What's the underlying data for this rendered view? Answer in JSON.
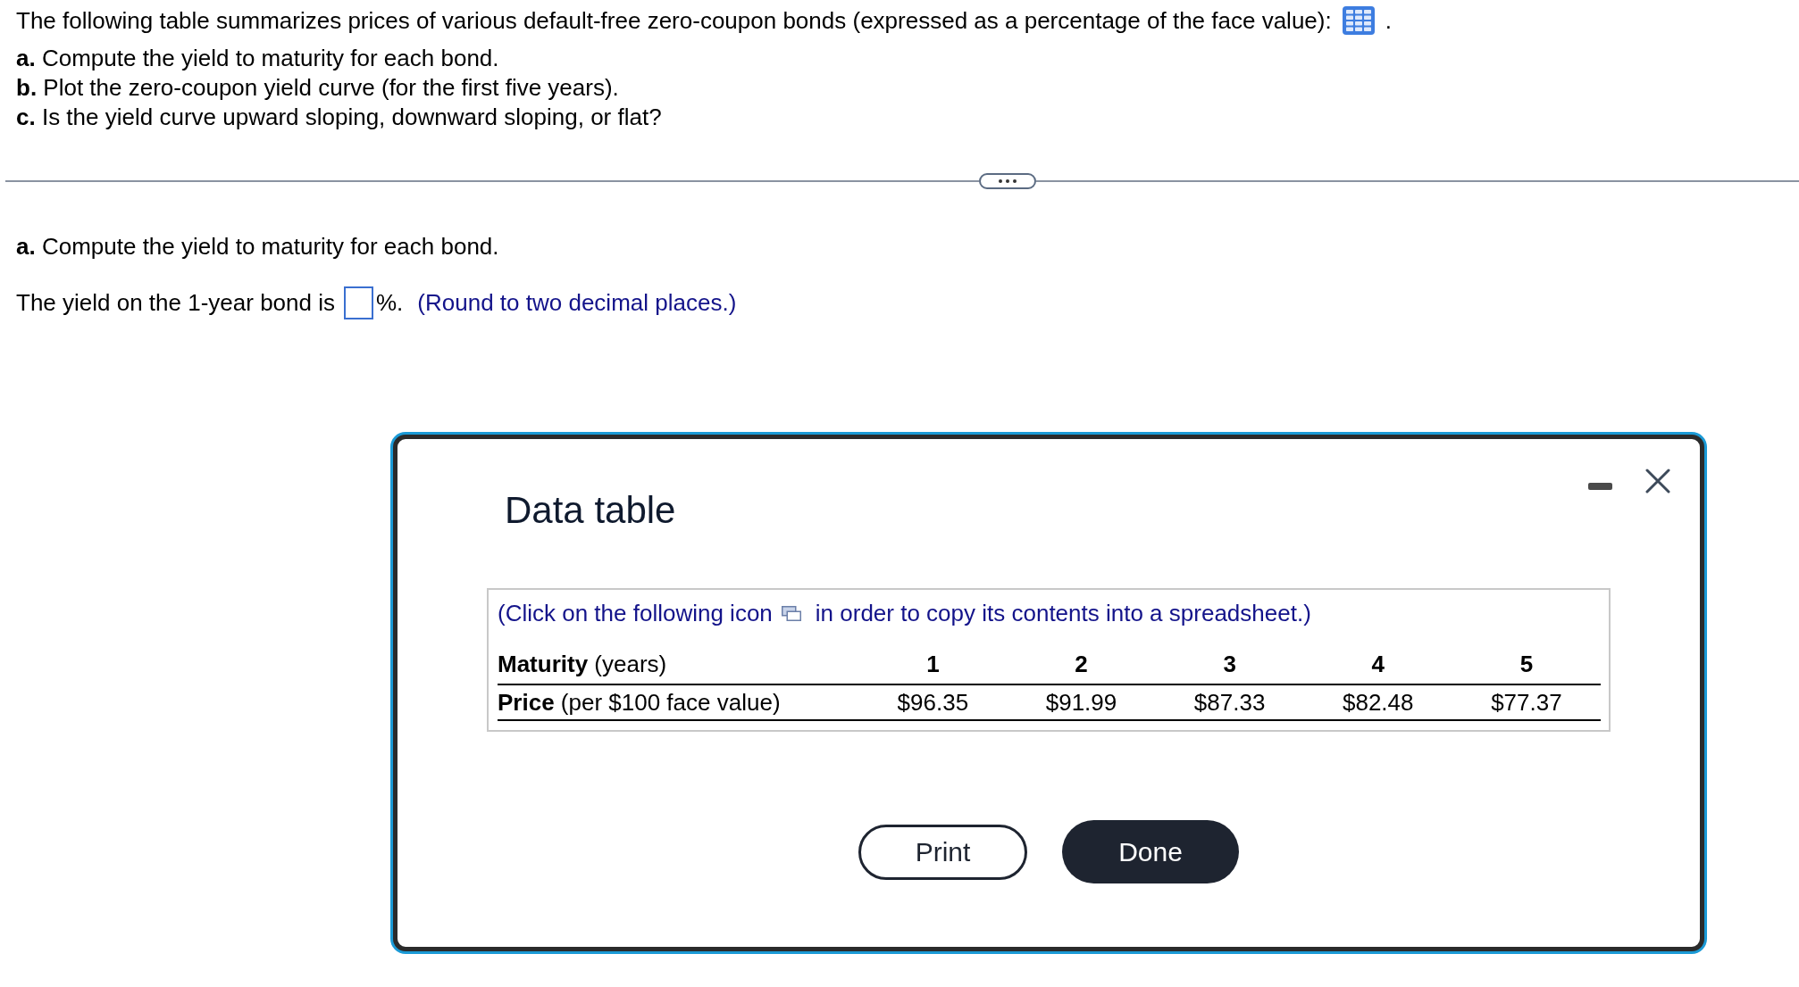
{
  "question": {
    "intro": "The following table summarizes prices of various default-free zero-coupon bonds (expressed as a percentage of the face value):",
    "intro_end": ".",
    "parts": [
      "**a.** Compute the yield to maturity for each bond.",
      "**b.** Plot the zero-coupon yield curve (for the first five years).",
      "**c.** Is the yield curve upward sloping, downward sloping, or flat?"
    ]
  },
  "answer_section": {
    "heading": "**a.** Compute the yield to maturity for each bond.",
    "prompt": "The yield on the 1-year bond is",
    "unit": "%.",
    "hint": "(Round to two decimal places.)"
  },
  "dialog": {
    "title": "Data table",
    "note_before": "(Click on the following icon",
    "note_after": "in order to copy its contents into a spreadsheet.)",
    "table": {
      "rows": [
        {
          "kind": "header",
          "label": "**Maturity** (years)",
          "cells": [
            "1",
            "2",
            "3",
            "4",
            "5"
          ]
        },
        {
          "kind": "data",
          "label": "**Price** (per $100 face value)",
          "cells": [
            "$96.35",
            "$91.99",
            "$87.33",
            "$82.48",
            "$77.37"
          ]
        }
      ]
    },
    "buttons": [
      {
        "label": "Print",
        "kind": "secondary"
      },
      {
        "label": "Done",
        "kind": "primary"
      }
    ]
  }
}
